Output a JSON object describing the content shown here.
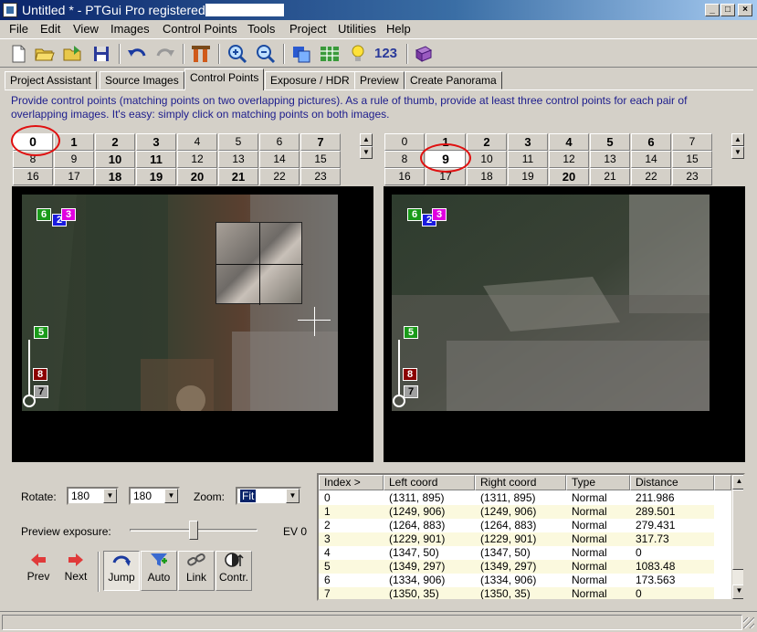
{
  "window": {
    "title": "Untitled * - PTGui Pro registered to",
    "min_glyph": "_",
    "max_glyph": "□",
    "close_glyph": "×"
  },
  "menu": [
    "File",
    "Edit",
    "View",
    "Images",
    "Control Points",
    "Tools",
    "Project",
    "Utilities",
    "Help"
  ],
  "toolbar": {
    "number_label": "123"
  },
  "tabs": [
    "Project Assistant",
    "Source Images",
    "Control Points",
    "Exposure / HDR",
    "Preview",
    "Create Panorama"
  ],
  "active_tab": "Control Points",
  "hint": "Provide control points (matching points on two overlapping pictures). As a rule of thumb, provide at least three control points for each pair of overlapping images. It's easy: simply click on matching points on both images.",
  "left_images": {
    "selected": "0",
    "numbers": [
      "0",
      "1",
      "2",
      "3",
      "4",
      "5",
      "6",
      "7",
      "8",
      "9",
      "10",
      "11",
      "12",
      "13",
      "14",
      "15",
      "16",
      "17",
      "18",
      "19",
      "20",
      "21",
      "22",
      "23"
    ],
    "bold": [
      "0",
      "1",
      "2",
      "3",
      "7",
      "10",
      "11",
      "18",
      "19",
      "20",
      "21"
    ]
  },
  "right_images": {
    "selected": "9",
    "numbers": [
      "0",
      "1",
      "2",
      "3",
      "4",
      "5",
      "6",
      "7",
      "8",
      "9",
      "10",
      "11",
      "12",
      "13",
      "14",
      "15",
      "16",
      "17",
      "18",
      "19",
      "20",
      "21",
      "22",
      "23"
    ],
    "bold": [
      "1",
      "2",
      "3",
      "4",
      "5",
      "6",
      "9",
      "20"
    ]
  },
  "markers": {
    "top_cluster": [
      "6",
      "2",
      "3"
    ],
    "point_5": "5",
    "point_8": "8",
    "point_7": "7"
  },
  "controls": {
    "rotate_label": "Rotate:",
    "rotate_left": "180",
    "rotate_right": "180",
    "zoom_label": "Zoom:",
    "zoom_value": "Fit",
    "preview_exposure_label": "Preview exposure:",
    "preview_exposure_level": 0.5,
    "ev_label": "EV 0",
    "prev_label": "Prev",
    "next_label": "Next",
    "jump_label": "Jump",
    "auto_label": "Auto",
    "link_label": "Link",
    "contr_label": "Contr."
  },
  "table": {
    "columns": [
      "Index >",
      "Left coord",
      "Right coord",
      "Type",
      "Distance"
    ],
    "rows": [
      [
        "0",
        "(1311, 895)",
        "(1311, 895)",
        "Normal",
        "211.986"
      ],
      [
        "1",
        "(1249, 906)",
        "(1249, 906)",
        "Normal",
        "289.501"
      ],
      [
        "2",
        "(1264, 883)",
        "(1264, 883)",
        "Normal",
        "279.431"
      ],
      [
        "3",
        "(1229, 901)",
        "(1229, 901)",
        "Normal",
        "317.73"
      ],
      [
        "4",
        "(1347, 50)",
        "(1347, 50)",
        "Normal",
        "0"
      ],
      [
        "5",
        "(1349, 297)",
        "(1349, 297)",
        "Normal",
        "1083.48"
      ],
      [
        "6",
        "(1334, 906)",
        "(1334, 906)",
        "Normal",
        "173.563"
      ],
      [
        "7",
        "(1350, 35)",
        "(1350, 35)",
        "Normal",
        "0"
      ]
    ]
  },
  "colors": {
    "title_bar": "#0a246a",
    "hint_text": "#1c1c8c",
    "highlight_circle": "#e01010",
    "marker_green": "#1a9a1a",
    "marker_darkred": "#8b0000",
    "marker_gray": "#a0a0a0",
    "marker_blue": "#1a1ae0",
    "marker_magenta": "#e000e0",
    "row_alt": "#fbf9de"
  }
}
